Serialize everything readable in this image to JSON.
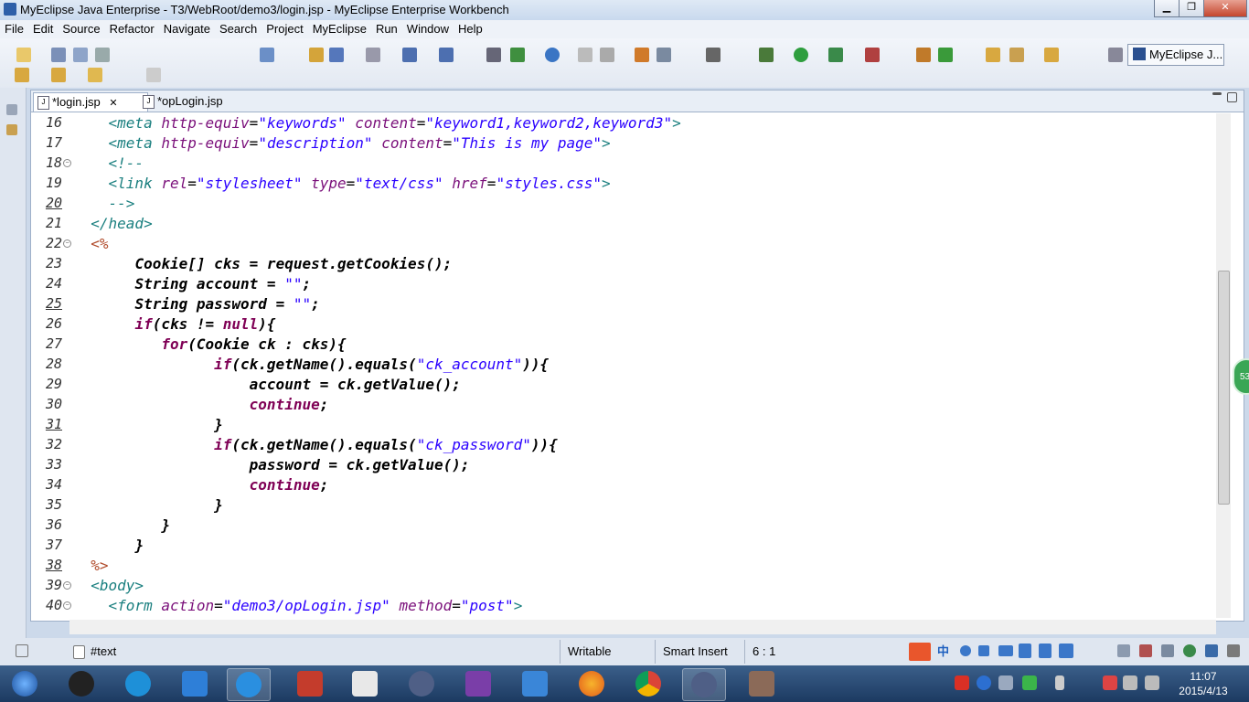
{
  "window": {
    "title": "MyEclipse Java Enterprise - T3/WebRoot/demo3/login.jsp - MyEclipse Enterprise Workbench",
    "min": "▁",
    "max": "❐",
    "close": "✕"
  },
  "menu": [
    "File",
    "Edit",
    "Source",
    "Refactor",
    "Navigate",
    "Search",
    "Project",
    "MyEclipse",
    "Run",
    "Window",
    "Help"
  ],
  "perspective": {
    "label": "MyEclipse J..."
  },
  "tabs": [
    {
      "label": "*login.jsp",
      "close": "✕",
      "active": true
    },
    {
      "label": "*opLogin.jsp",
      "active": false
    }
  ],
  "editor": {
    "lines": [
      {
        "n": "16",
        "html": "    <span class='tag'>&lt;meta</span> <span class='attr'>http-equiv</span>=<span class='str'>\"keywords\"</span> <span class='attr'>content</span>=<span class='str'>\"keyword1,keyword2,keyword3\"</span><span class='tag'>&gt;</span>"
      },
      {
        "n": "17",
        "html": "    <span class='tag'>&lt;meta</span> <span class='attr'>http-equiv</span>=<span class='str'>\"description\"</span> <span class='attr'>content</span>=<span class='str'>\"This is my page\"</span><span class='tag'>&gt;</span>"
      },
      {
        "n": "18",
        "html": "    <span class='tag'>&lt;!--</span>",
        "fold": true
      },
      {
        "n": "19",
        "html": "    <span class='tag'>&lt;link</span> <span class='attr'>rel</span>=<span class='str'>\"stylesheet\"</span> <span class='attr'>type</span>=<span class='str'>\"text/css\"</span> <span class='attr'>href</span>=<span class='str'>\"styles.css\"</span><span class='tag'>&gt;</span>"
      },
      {
        "n": "20",
        "html": "    <span class='tag'>--&gt;</span>",
        "ul": true
      },
      {
        "n": "21",
        "html": "  <span class='tag'>&lt;/head&gt;</span>"
      },
      {
        "n": "22",
        "html": "  <span class='jsp'>&lt;%</span>",
        "fold": true
      },
      {
        "n": "23",
        "html": "       <span class='bold'>Cookie[] cks = request.getCookies();</span>"
      },
      {
        "n": "24",
        "html": "       <span class='bold'>String account = </span><span class='str'>\"\"</span><span class='bold'>;</span>"
      },
      {
        "n": "25",
        "html": "       <span class='bold'>String password = </span><span class='str'>\"\"</span><span class='bold'>;</span>",
        "ul": true
      },
      {
        "n": "26",
        "html": "       <span class='kw'>if</span><span class='bold'>(cks != </span><span class='kw'>null</span><span class='bold'>){</span>"
      },
      {
        "n": "27",
        "html": "          <span class='kw'>for</span><span class='bold'>(Cookie ck : cks){</span>"
      },
      {
        "n": "28",
        "html": "                <span class='kw'>if</span><span class='bold'>(ck.getName().equals(</span><span class='str'>\"ck_account\"</span><span class='bold'>)){</span>"
      },
      {
        "n": "29",
        "html": "                    <span class='bold'>account = ck.getValue();</span>"
      },
      {
        "n": "30",
        "html": "                    <span class='kw'>continue</span><span class='bold'>;</span>"
      },
      {
        "n": "31",
        "html": "                <span class='bold'>}</span>",
        "ul": true
      },
      {
        "n": "32",
        "html": "                <span class='kw'>if</span><span class='bold'>(ck.getName().equals(</span><span class='str'>\"ck_password\"</span><span class='bold'>)){</span>"
      },
      {
        "n": "33",
        "html": "                    <span class='bold'>password = ck.getValue();</span>"
      },
      {
        "n": "34",
        "html": "                    <span class='kw'>continue</span><span class='bold'>;</span>"
      },
      {
        "n": "35",
        "html": "                <span class='bold'>}</span>"
      },
      {
        "n": "36",
        "html": "          <span class='bold'>}</span>"
      },
      {
        "n": "37",
        "html": "       <span class='bold'>}</span>"
      },
      {
        "n": "38",
        "html": "  <span class='jsp'>%&gt;</span>",
        "ul": true
      },
      {
        "n": "39",
        "html": "  <span class='tag'>&lt;body&gt;</span>",
        "fold": true
      },
      {
        "n": "40",
        "html": "    <span class='tag'>&lt;form</span> <span class='attr'>action</span>=<span class='str'>\"demo3/opLogin.jsp\"</span> <span class='attr'>method</span>=<span class='str'>\"post\"</span><span class='tag'>&gt;</span>",
        "fold": true
      }
    ]
  },
  "overview_badge": "53",
  "status": {
    "text": "#text",
    "writable": "Writable",
    "insert": "Smart Insert",
    "position": "6 : 1"
  },
  "ime": {
    "cn": "中"
  },
  "tray_icons": [
    "sogou-s-icon",
    "help-icon",
    "network-icon",
    "battery-icon",
    "flag-icon",
    "signal-icon",
    "speaker-icon"
  ],
  "clock": {
    "time": "11:07",
    "date": "2015/4/13"
  },
  "taskbar_apps": [
    "start",
    "qq",
    "k-app",
    "cloud",
    "ie",
    "doc-editor",
    "notes",
    "eclipse",
    "visual-studio",
    "monitor",
    "firefox",
    "chrome",
    "myeclipse-active",
    "avatar-photo"
  ]
}
